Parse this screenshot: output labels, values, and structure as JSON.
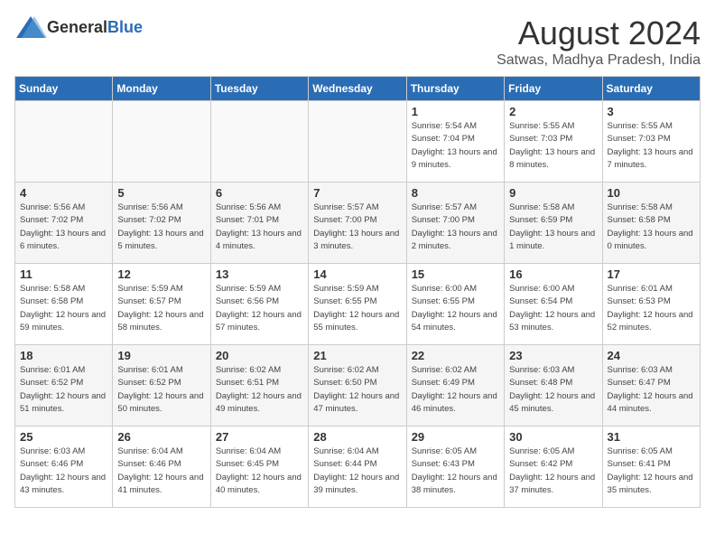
{
  "header": {
    "logo_general": "General",
    "logo_blue": "Blue",
    "title": "August 2024",
    "location": "Satwas, Madhya Pradesh, India"
  },
  "weekdays": [
    "Sunday",
    "Monday",
    "Tuesday",
    "Wednesday",
    "Thursday",
    "Friday",
    "Saturday"
  ],
  "weeks": [
    [
      {
        "day": "",
        "empty": true
      },
      {
        "day": "",
        "empty": true
      },
      {
        "day": "",
        "empty": true
      },
      {
        "day": "",
        "empty": true
      },
      {
        "day": "1",
        "sunrise": "5:54 AM",
        "sunset": "7:04 PM",
        "daylight": "13 hours and 9 minutes."
      },
      {
        "day": "2",
        "sunrise": "5:55 AM",
        "sunset": "7:03 PM",
        "daylight": "13 hours and 8 minutes."
      },
      {
        "day": "3",
        "sunrise": "5:55 AM",
        "sunset": "7:03 PM",
        "daylight": "13 hours and 7 minutes."
      }
    ],
    [
      {
        "day": "4",
        "sunrise": "5:56 AM",
        "sunset": "7:02 PM",
        "daylight": "13 hours and 6 minutes."
      },
      {
        "day": "5",
        "sunrise": "5:56 AM",
        "sunset": "7:02 PM",
        "daylight": "13 hours and 5 minutes."
      },
      {
        "day": "6",
        "sunrise": "5:56 AM",
        "sunset": "7:01 PM",
        "daylight": "13 hours and 4 minutes."
      },
      {
        "day": "7",
        "sunrise": "5:57 AM",
        "sunset": "7:00 PM",
        "daylight": "13 hours and 3 minutes."
      },
      {
        "day": "8",
        "sunrise": "5:57 AM",
        "sunset": "7:00 PM",
        "daylight": "13 hours and 2 minutes."
      },
      {
        "day": "9",
        "sunrise": "5:58 AM",
        "sunset": "6:59 PM",
        "daylight": "13 hours and 1 minute."
      },
      {
        "day": "10",
        "sunrise": "5:58 AM",
        "sunset": "6:58 PM",
        "daylight": "13 hours and 0 minutes."
      }
    ],
    [
      {
        "day": "11",
        "sunrise": "5:58 AM",
        "sunset": "6:58 PM",
        "daylight": "12 hours and 59 minutes."
      },
      {
        "day": "12",
        "sunrise": "5:59 AM",
        "sunset": "6:57 PM",
        "daylight": "12 hours and 58 minutes."
      },
      {
        "day": "13",
        "sunrise": "5:59 AM",
        "sunset": "6:56 PM",
        "daylight": "12 hours and 57 minutes."
      },
      {
        "day": "14",
        "sunrise": "5:59 AM",
        "sunset": "6:55 PM",
        "daylight": "12 hours and 55 minutes."
      },
      {
        "day": "15",
        "sunrise": "6:00 AM",
        "sunset": "6:55 PM",
        "daylight": "12 hours and 54 minutes."
      },
      {
        "day": "16",
        "sunrise": "6:00 AM",
        "sunset": "6:54 PM",
        "daylight": "12 hours and 53 minutes."
      },
      {
        "day": "17",
        "sunrise": "6:01 AM",
        "sunset": "6:53 PM",
        "daylight": "12 hours and 52 minutes."
      }
    ],
    [
      {
        "day": "18",
        "sunrise": "6:01 AM",
        "sunset": "6:52 PM",
        "daylight": "12 hours and 51 minutes."
      },
      {
        "day": "19",
        "sunrise": "6:01 AM",
        "sunset": "6:52 PM",
        "daylight": "12 hours and 50 minutes."
      },
      {
        "day": "20",
        "sunrise": "6:02 AM",
        "sunset": "6:51 PM",
        "daylight": "12 hours and 49 minutes."
      },
      {
        "day": "21",
        "sunrise": "6:02 AM",
        "sunset": "6:50 PM",
        "daylight": "12 hours and 47 minutes."
      },
      {
        "day": "22",
        "sunrise": "6:02 AM",
        "sunset": "6:49 PM",
        "daylight": "12 hours and 46 minutes."
      },
      {
        "day": "23",
        "sunrise": "6:03 AM",
        "sunset": "6:48 PM",
        "daylight": "12 hours and 45 minutes."
      },
      {
        "day": "24",
        "sunrise": "6:03 AM",
        "sunset": "6:47 PM",
        "daylight": "12 hours and 44 minutes."
      }
    ],
    [
      {
        "day": "25",
        "sunrise": "6:03 AM",
        "sunset": "6:46 PM",
        "daylight": "12 hours and 43 minutes."
      },
      {
        "day": "26",
        "sunrise": "6:04 AM",
        "sunset": "6:46 PM",
        "daylight": "12 hours and 41 minutes."
      },
      {
        "day": "27",
        "sunrise": "6:04 AM",
        "sunset": "6:45 PM",
        "daylight": "12 hours and 40 minutes."
      },
      {
        "day": "28",
        "sunrise": "6:04 AM",
        "sunset": "6:44 PM",
        "daylight": "12 hours and 39 minutes."
      },
      {
        "day": "29",
        "sunrise": "6:05 AM",
        "sunset": "6:43 PM",
        "daylight": "12 hours and 38 minutes."
      },
      {
        "day": "30",
        "sunrise": "6:05 AM",
        "sunset": "6:42 PM",
        "daylight": "12 hours and 37 minutes."
      },
      {
        "day": "31",
        "sunrise": "6:05 AM",
        "sunset": "6:41 PM",
        "daylight": "12 hours and 35 minutes."
      }
    ]
  ]
}
